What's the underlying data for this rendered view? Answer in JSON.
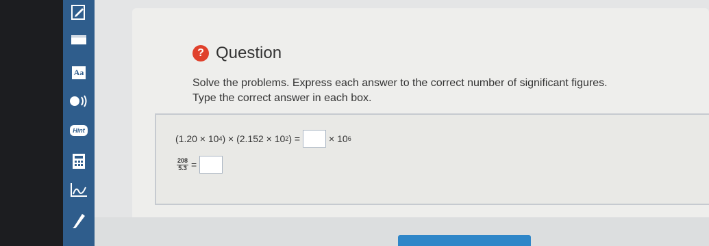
{
  "toolbar": {
    "icons": [
      "edit-icon",
      "book-icon",
      "text-size-icon",
      "audio-icon",
      "hint-icon",
      "calculator-icon",
      "graph-icon",
      "highlighter-icon"
    ],
    "text_size_label": "Aa",
    "hint_label": "Hint"
  },
  "question": {
    "title": "Question",
    "icon_text": "?",
    "instruction1": "Solve the problems. Express each answer to the correct number of significant figures.",
    "instruction2": "Type the correct answer in each box."
  },
  "problems": {
    "p1": {
      "open1": "(1.20 × 10",
      "exp1": "4",
      "mid": ") × (2.152 × 10",
      "exp2": "2",
      "close": ") =",
      "answer": "",
      "suffix": "× 10",
      "suffix_exp": "6"
    },
    "p2": {
      "numerator": "208",
      "denominator": "5.3",
      "equals": "=",
      "answer": ""
    }
  },
  "colors": {
    "toolbar": "#2f5d8c",
    "accent": "#2f86c8",
    "question_icon": "#e0412c"
  }
}
